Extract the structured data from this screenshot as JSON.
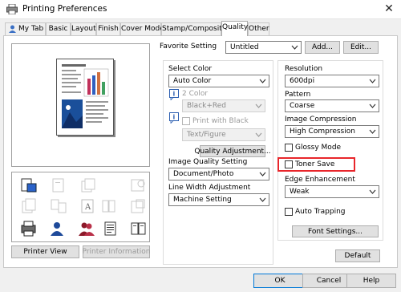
{
  "window": {
    "title": "Printing Preferences"
  },
  "tabs": [
    {
      "label": "My Tab",
      "active": false
    },
    {
      "label": "Basic",
      "active": false
    },
    {
      "label": "Layout",
      "active": false
    },
    {
      "label": "Finish",
      "active": false
    },
    {
      "label": "Cover Mode",
      "active": false
    },
    {
      "label": "Stamp/Composition",
      "active": false
    },
    {
      "label": "Quality",
      "active": true
    },
    {
      "label": "Other",
      "active": false
    }
  ],
  "favorite": {
    "label": "Favorite Setting",
    "value": "Untitled",
    "add_label": "Add...",
    "edit_label": "Edit..."
  },
  "color": {
    "select_color_label": "Select Color",
    "select_color_value": "Auto Color",
    "two_color_label": "2 Color",
    "two_color_value": "Black+Red",
    "print_with_black_label": "Print with Black",
    "text_figure_value": "Text/Figure",
    "quality_adjustment_label": "Quality Adjustment..."
  },
  "image_quality": {
    "label": "Image Quality Setting",
    "value": "Document/Photo"
  },
  "line_width": {
    "label": "Line Width Adjustment",
    "value": "Machine Setting"
  },
  "right": {
    "resolution_label": "Resolution",
    "resolution_value": "600dpi",
    "pattern_label": "Pattern",
    "pattern_value": "Coarse",
    "compression_label": "Image Compression",
    "compression_value": "High Compression",
    "glossy_label": "Glossy Mode",
    "toner_save_label": "Toner Save",
    "edge_label": "Edge Enhancement",
    "edge_value": "Weak",
    "auto_trapping_label": "Auto Trapping",
    "font_settings_label": "Font Settings..."
  },
  "preview": {
    "printer_view_label": "Printer View",
    "printer_info_label": "Printer Information"
  },
  "footer": {
    "default_label": "Default",
    "ok_label": "OK",
    "cancel_label": "Cancel",
    "help_label": "Help"
  },
  "colors": {
    "highlight": "#e8262b",
    "accent": "#0078d7"
  }
}
